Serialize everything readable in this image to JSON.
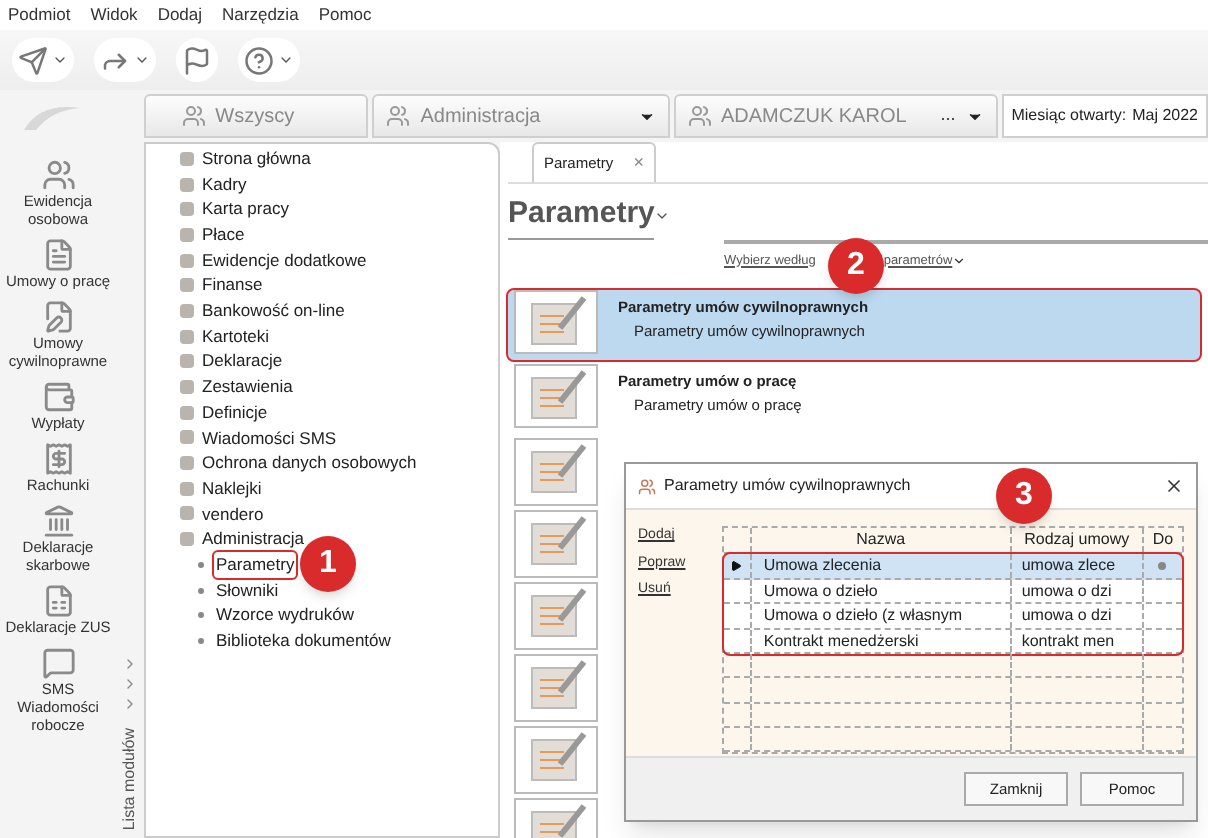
{
  "menu_bar": [
    "Podmiot",
    "Widok",
    "Dodaj",
    "Narzędzia",
    "Pomoc"
  ],
  "toolbar": [
    {
      "dropdown": true
    },
    {
      "dropdown": true
    },
    {
      "dropdown": false
    },
    {
      "dropdown": true
    }
  ],
  "context_tabs": [
    {
      "label": "Wszyscy",
      "dropdown": false
    },
    {
      "label": "Administracja",
      "dropdown": true
    },
    {
      "label": "ADAMCZUK KAROL",
      "more": "...",
      "dropdown": true
    }
  ],
  "open_month": {
    "label": "Miesiąc otwarty:",
    "value": "Maj 2022"
  },
  "modules": [
    "Ewidencja osobowa",
    "Umowy o pracę",
    "Umowy cywilnoprawne",
    "Wypłaty",
    "Rachunki",
    "Deklaracje skarbowe",
    "Deklaracje ZUS",
    "SMS Wiadomości robocze"
  ],
  "module_list_label": "Lista modułów",
  "tree": [
    {
      "label": "Strona główna"
    },
    {
      "label": "Kadry"
    },
    {
      "label": "Karta pracy"
    },
    {
      "label": "Płace"
    },
    {
      "label": "Ewidencje dodatkowe"
    },
    {
      "label": "Finanse"
    },
    {
      "label": "Bankowość on-line"
    },
    {
      "label": "Kartoteki"
    },
    {
      "label": "Deklaracje"
    },
    {
      "label": "Zestawienia"
    },
    {
      "label": "Definicje"
    },
    {
      "label": "Wiadomości SMS"
    },
    {
      "label": "Ochrona danych osobowych"
    },
    {
      "label": "Naklejki"
    },
    {
      "label": "vendero"
    },
    {
      "label": "Administracja",
      "children": [
        {
          "label": "Parametry",
          "highlighted": true
        },
        {
          "label": "Słowniki",
          "highlighted": false
        },
        {
          "label": "Wzorce wydruków",
          "highlighted": false
        },
        {
          "label": "Biblioteka dokumentów",
          "highlighted": false
        }
      ]
    }
  ],
  "document_tab": {
    "label": "Parametry",
    "close": "×"
  },
  "heading": "Parametry",
  "filter_link": [
    "Wybierz według",
    "parametrów"
  ],
  "parameters": [
    {
      "title": "Parametry umów cywilnoprawnych",
      "subtitle": "Parametry umów cywilnoprawnych",
      "selected": true,
      "highlighted": true
    },
    {
      "title": "Parametry umów o pracę",
      "subtitle": "Parametry umów o pracę",
      "selected": false,
      "highlighted": false
    }
  ],
  "dialog": {
    "title": "Parametry umów cywilnoprawnych",
    "actions": [
      "Dodaj",
      "Popraw",
      "Usuń"
    ],
    "columns": [
      "Nazwa",
      "Rodzaj umowy",
      "Do"
    ],
    "rows_highlighted": true,
    "rows": [
      {
        "cells": [
          "Umowa zlecenia",
          "umowa zlece"
        ],
        "selected": true,
        "flag": true
      },
      {
        "cells": [
          "Umowa o dzieło",
          "umowa o dzi"
        ],
        "selected": false,
        "flag": false
      },
      {
        "cells": [
          "Umowa o dzieło (z własnym",
          "umowa o dzi"
        ],
        "selected": false,
        "flag": false
      },
      {
        "cells": [
          "Kontrakt menedżerski",
          "kontrakt men"
        ],
        "selected": false,
        "flag": false
      }
    ],
    "buttons": [
      "Zamknij",
      "Pomoc"
    ]
  },
  "callouts": [
    "1",
    "2",
    "3"
  ]
}
